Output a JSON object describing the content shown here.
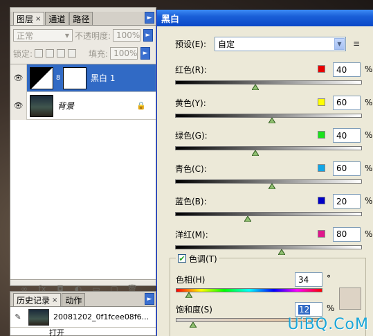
{
  "layers_panel": {
    "tabs": [
      {
        "label": "图层",
        "close": "×"
      },
      {
        "label": "通道"
      },
      {
        "label": "路径"
      }
    ],
    "menu_arrow": "►",
    "blend_mode": "正常",
    "opacity_label": "不透明度:",
    "opacity_value": "100%",
    "lock_label": "锁定:",
    "fill_label": "填充:",
    "fill_value": "100%",
    "layers": [
      {
        "name": "黑白 1",
        "selected": true
      },
      {
        "name": "背景",
        "italic": true
      }
    ],
    "chain_glyph": "8",
    "bottom_icons": [
      "link-icon",
      "fx-icon",
      "mask-icon",
      "adjustment-icon",
      "group-icon",
      "new-layer-icon",
      "trash-icon"
    ],
    "bottom_glyphs": [
      "∞",
      "fx",
      "◘",
      "◐",
      "▭",
      "▢",
      "🗑"
    ]
  },
  "history_panel": {
    "tabs": [
      {
        "label": "历史记录",
        "close": "×"
      },
      {
        "label": "动作"
      }
    ],
    "menu_arrow": "►",
    "snapshot_name": "20081202_0f1fcee08f6...",
    "next_item": "打开"
  },
  "bw_dialog": {
    "title": "黑白",
    "preset_label": "预设(E):",
    "preset_value": "自定",
    "preset_menu_glyph": "≡",
    "sliders": [
      {
        "key": "red",
        "label": "红色(R):",
        "value": "40",
        "color": "#e80000",
        "pos": 0.43
      },
      {
        "key": "yellow",
        "label": "黄色(Y):",
        "value": "60",
        "color": "#ffff00",
        "pos": 0.52
      },
      {
        "key": "green",
        "label": "绿色(G):",
        "value": "40",
        "color": "#1ce21c",
        "pos": 0.43
      },
      {
        "key": "cyan",
        "label": "青色(C):",
        "value": "60",
        "color": "#12a6e6",
        "pos": 0.52
      },
      {
        "key": "blue",
        "label": "蓝色(B):",
        "value": "20",
        "color": "#0000c8",
        "pos": 0.39
      },
      {
        "key": "magenta",
        "label": "洋红(M):",
        "value": "80",
        "color": "#e0168c",
        "pos": 0.57
      }
    ],
    "percent": "%",
    "tint": {
      "checkbox_label": "色调(T)",
      "checked": true,
      "hue_label": "色相(H)",
      "hue_value": "34",
      "hue_unit": "°",
      "hue_pos": 0.09,
      "sat_label": "饱和度(S)",
      "sat_value": "12",
      "sat_unit": "%",
      "sat_pos": 0.12,
      "swatch_color": "#ddd3c5"
    }
  },
  "watermark": "UiBQ.CoM"
}
